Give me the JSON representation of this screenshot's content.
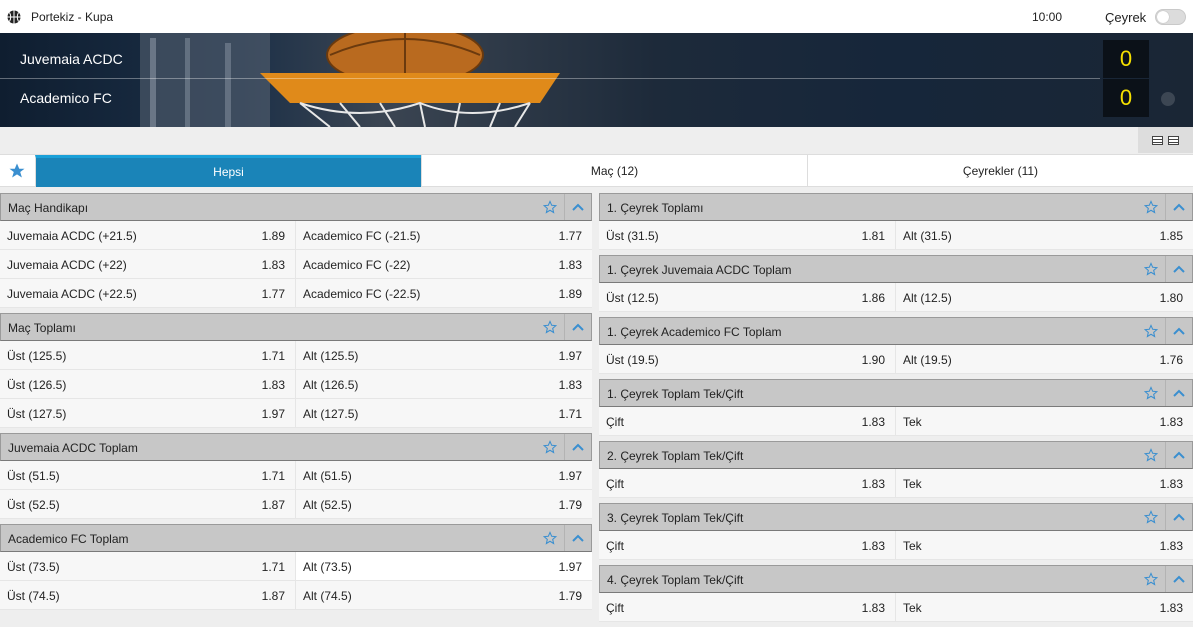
{
  "header": {
    "league": "Portekiz - Kupa",
    "time": "10:00",
    "period_label": "Çeyrek"
  },
  "match": {
    "home": "Juvemaia ACDC",
    "away": "Academico FC",
    "home_score": "0",
    "away_score": "0"
  },
  "tabs": [
    {
      "label": "Hepsi"
    },
    {
      "label": "Maç (12)"
    },
    {
      "label": "Çeyrekler (11)"
    }
  ],
  "left_markets": [
    {
      "title": "Maç Handikapı",
      "rows": [
        [
          {
            "label": "Juvemaia ACDC (+21.5)",
            "odd": "1.89"
          },
          {
            "label": "Academico FC (-21.5)",
            "odd": "1.77"
          }
        ],
        [
          {
            "label": "Juvemaia ACDC (+22)",
            "odd": "1.83"
          },
          {
            "label": "Academico FC (-22)",
            "odd": "1.83"
          }
        ],
        [
          {
            "label": "Juvemaia ACDC (+22.5)",
            "odd": "1.77"
          },
          {
            "label": "Academico FC (-22.5)",
            "odd": "1.89"
          }
        ]
      ]
    },
    {
      "title": "Maç Toplamı",
      "rows": [
        [
          {
            "label": "Üst (125.5)",
            "odd": "1.71"
          },
          {
            "label": "Alt (125.5)",
            "odd": "1.97"
          }
        ],
        [
          {
            "label": "Üst (126.5)",
            "odd": "1.83"
          },
          {
            "label": "Alt (126.5)",
            "odd": "1.83"
          }
        ],
        [
          {
            "label": "Üst (127.5)",
            "odd": "1.97"
          },
          {
            "label": "Alt (127.5)",
            "odd": "1.71"
          }
        ]
      ]
    },
    {
      "title": "Juvemaia ACDC Toplam",
      "rows": [
        [
          {
            "label": "Üst (51.5)",
            "odd": "1.71"
          },
          {
            "label": "Alt (51.5)",
            "odd": "1.97"
          }
        ],
        [
          {
            "label": "Üst (52.5)",
            "odd": "1.87"
          },
          {
            "label": "Alt (52.5)",
            "odd": "1.79"
          }
        ]
      ]
    },
    {
      "title": "Academico FC Toplam",
      "rows": [
        [
          {
            "label": "Üst (73.5)",
            "odd": "1.71"
          },
          {
            "label": "Alt (73.5)",
            "odd": "1.97"
          }
        ],
        [
          {
            "label": "Üst (74.5)",
            "odd": "1.87"
          },
          {
            "label": "Alt (74.5)",
            "odd": "1.79"
          }
        ]
      ]
    }
  ],
  "right_markets": [
    {
      "title": "1. Çeyrek Toplamı",
      "rows": [
        [
          {
            "label": "Üst (31.5)",
            "odd": "1.81"
          },
          {
            "label": "Alt (31.5)",
            "odd": "1.85"
          }
        ]
      ]
    },
    {
      "title": "1. Çeyrek Juvemaia ACDC Toplam",
      "rows": [
        [
          {
            "label": "Üst (12.5)",
            "odd": "1.86"
          },
          {
            "label": "Alt (12.5)",
            "odd": "1.80"
          }
        ]
      ]
    },
    {
      "title": "1. Çeyrek Academico FC Toplam",
      "rows": [
        [
          {
            "label": "Üst (19.5)",
            "odd": "1.90"
          },
          {
            "label": "Alt (19.5)",
            "odd": "1.76"
          }
        ]
      ]
    },
    {
      "title": "1. Çeyrek Toplam Tek/Çift",
      "rows": [
        [
          {
            "label": "Çift",
            "odd": "1.83"
          },
          {
            "label": "Tek",
            "odd": "1.83"
          }
        ]
      ]
    },
    {
      "title": "2. Çeyrek Toplam Tek/Çift",
      "rows": [
        [
          {
            "label": "Çift",
            "odd": "1.83"
          },
          {
            "label": "Tek",
            "odd": "1.83"
          }
        ]
      ]
    },
    {
      "title": "3. Çeyrek Toplam Tek/Çift",
      "rows": [
        [
          {
            "label": "Çift",
            "odd": "1.83"
          },
          {
            "label": "Tek",
            "odd": "1.83"
          }
        ]
      ]
    },
    {
      "title": "4. Çeyrek Toplam Tek/Çift",
      "rows": [
        [
          {
            "label": "Çift",
            "odd": "1.83"
          },
          {
            "label": "Tek",
            "odd": "1.83"
          }
        ]
      ]
    }
  ],
  "colors": {
    "active_tab": "#1a84b8",
    "score": "#f5e000",
    "star": "#3a8fd0"
  }
}
